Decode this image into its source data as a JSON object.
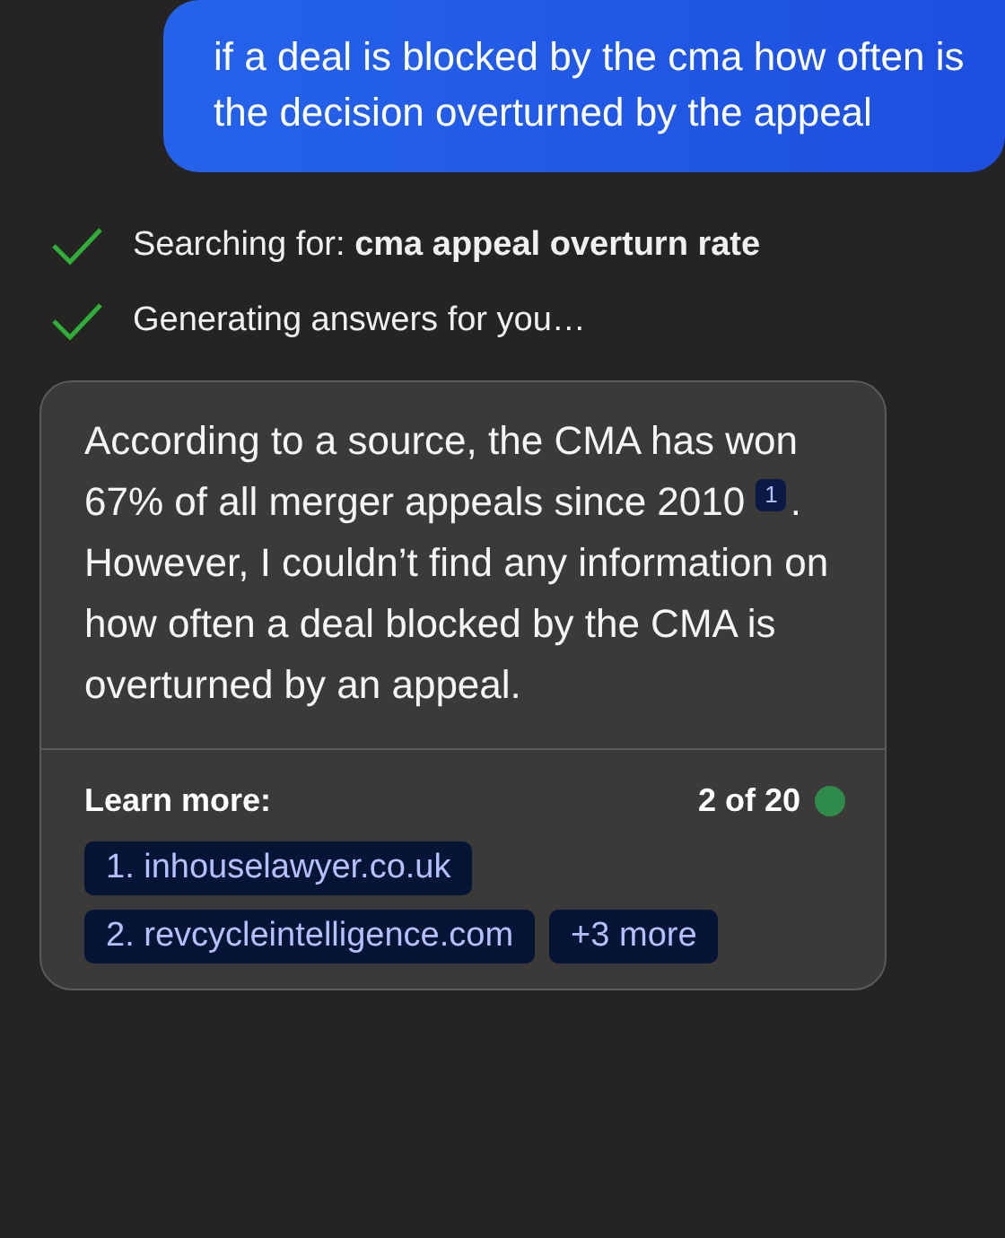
{
  "user_message": "if a deal is blocked by the cma how often is the decision overturned by the appeal",
  "steps": [
    {
      "text": "Searching for: **cma appeal overturn rate**",
      "done": true
    },
    {
      "text": "Generating answers for you…",
      "done": true
    }
  ],
  "answer": {
    "before": "According to a source, the CMA has won 67% of all merger appeals since 2010",
    "citation": "1",
    "after": ". However, I couldn’t find any information on how often a deal blocked by the CMA is overturned by an appeal."
  },
  "learn_more": {
    "label": "Learn more:",
    "count": "2 of 20",
    "color": "#2e8b4a",
    "sources": [
      "1. inhouselawyer.co.uk",
      "2. revcycleintelligence.com"
    ],
    "more": "+3 more"
  }
}
